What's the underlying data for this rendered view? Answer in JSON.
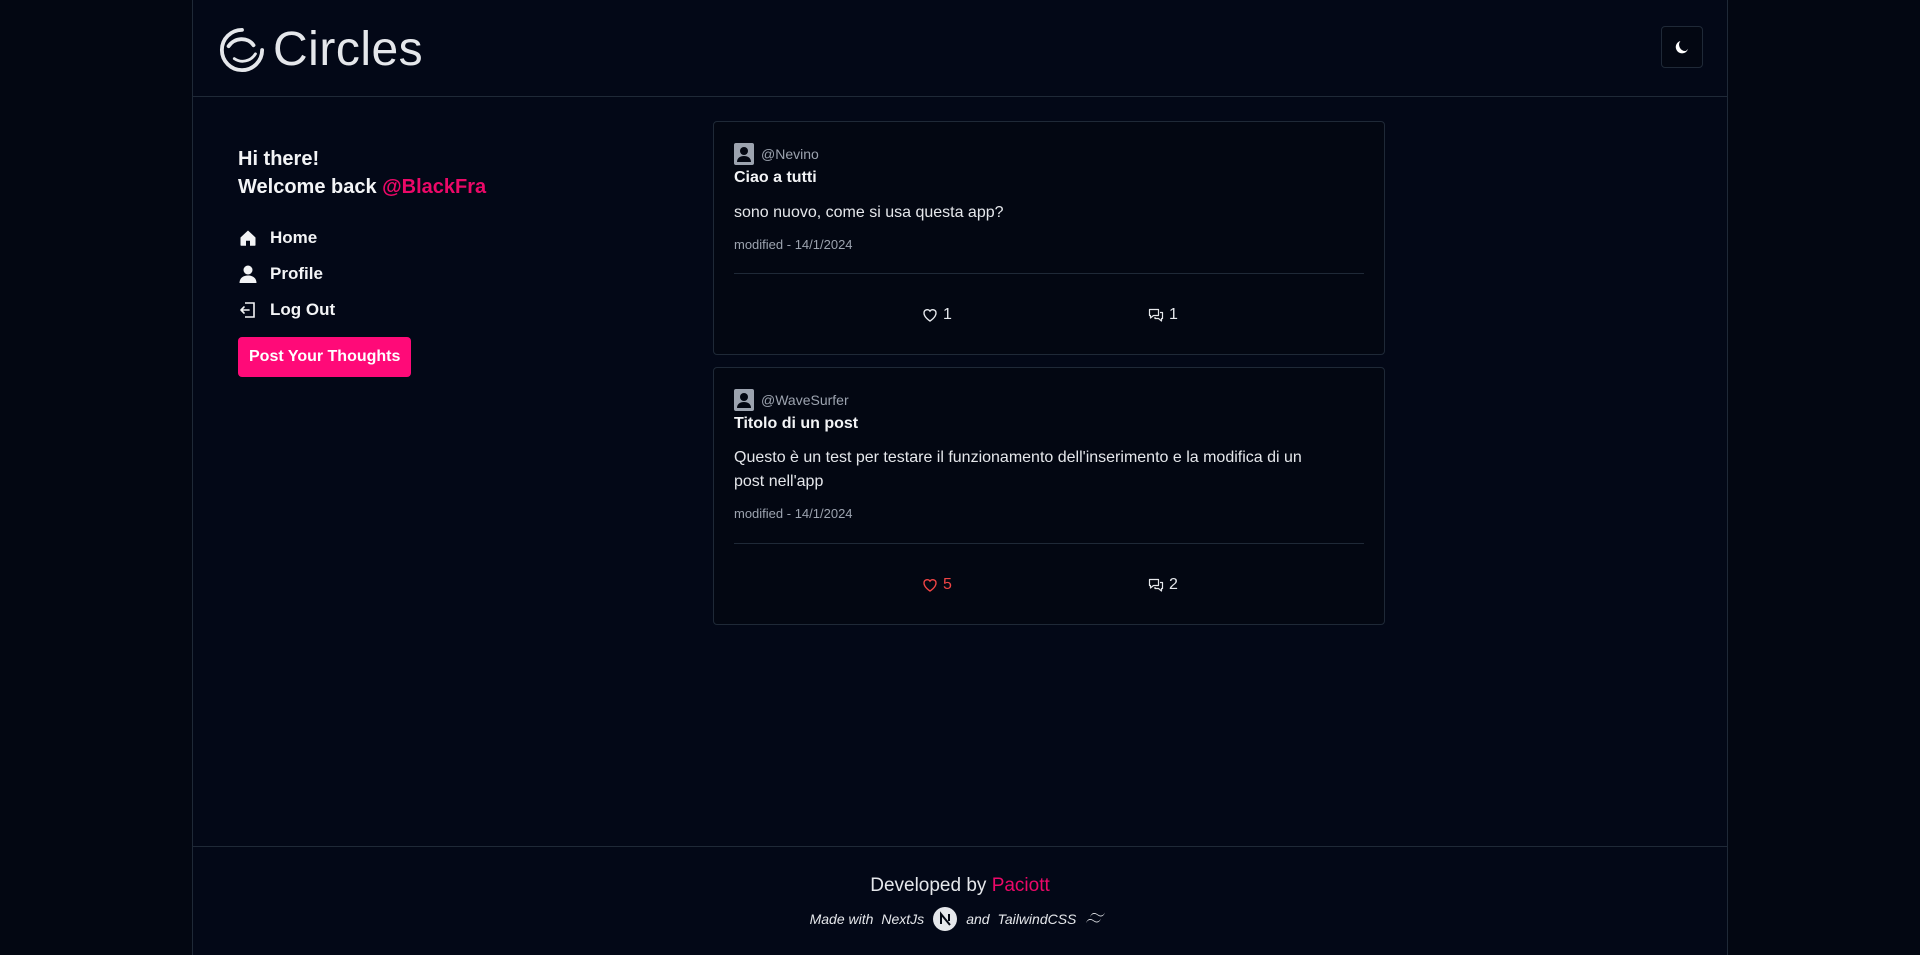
{
  "header": {
    "app_name": "Circles",
    "theme_toggle_icon": "moon-icon"
  },
  "sidebar": {
    "greeting_line1": "Hi there!",
    "greeting_line2_prefix": "Welcome back ",
    "username": "@BlackFra",
    "nav": [
      {
        "label": "Home",
        "icon": "home-icon"
      },
      {
        "label": "Profile",
        "icon": "user-icon"
      },
      {
        "label": "Log Out",
        "icon": "logout-icon"
      }
    ],
    "post_button_label": "Post Your Thoughts"
  },
  "posts": [
    {
      "author": "@Nevino",
      "title": "Ciao a tutti",
      "body": "sono nuovo, come si usa questa app?",
      "meta": "modified - 14/1/2024",
      "likes": "1",
      "comments": "1",
      "liked": false
    },
    {
      "author": "@WaveSurfer",
      "title": "Titolo di un post",
      "body": "Questo è un test per testare il funzionamento dell'inserimento e la modifica di un post nell'app",
      "meta": "modified - 14/1/2024",
      "likes": "5",
      "comments": "2",
      "liked": true
    }
  ],
  "footer": {
    "developed_by": "Developed by ",
    "developer": "Paciott",
    "made_with": "Made with",
    "tech1": "NextJs",
    "and": "and",
    "tech2": "TailwindCSS"
  },
  "colors": {
    "background": "#030712",
    "accent": "#ec0868",
    "button": "#ff0a78",
    "liked": "#ef4444"
  }
}
